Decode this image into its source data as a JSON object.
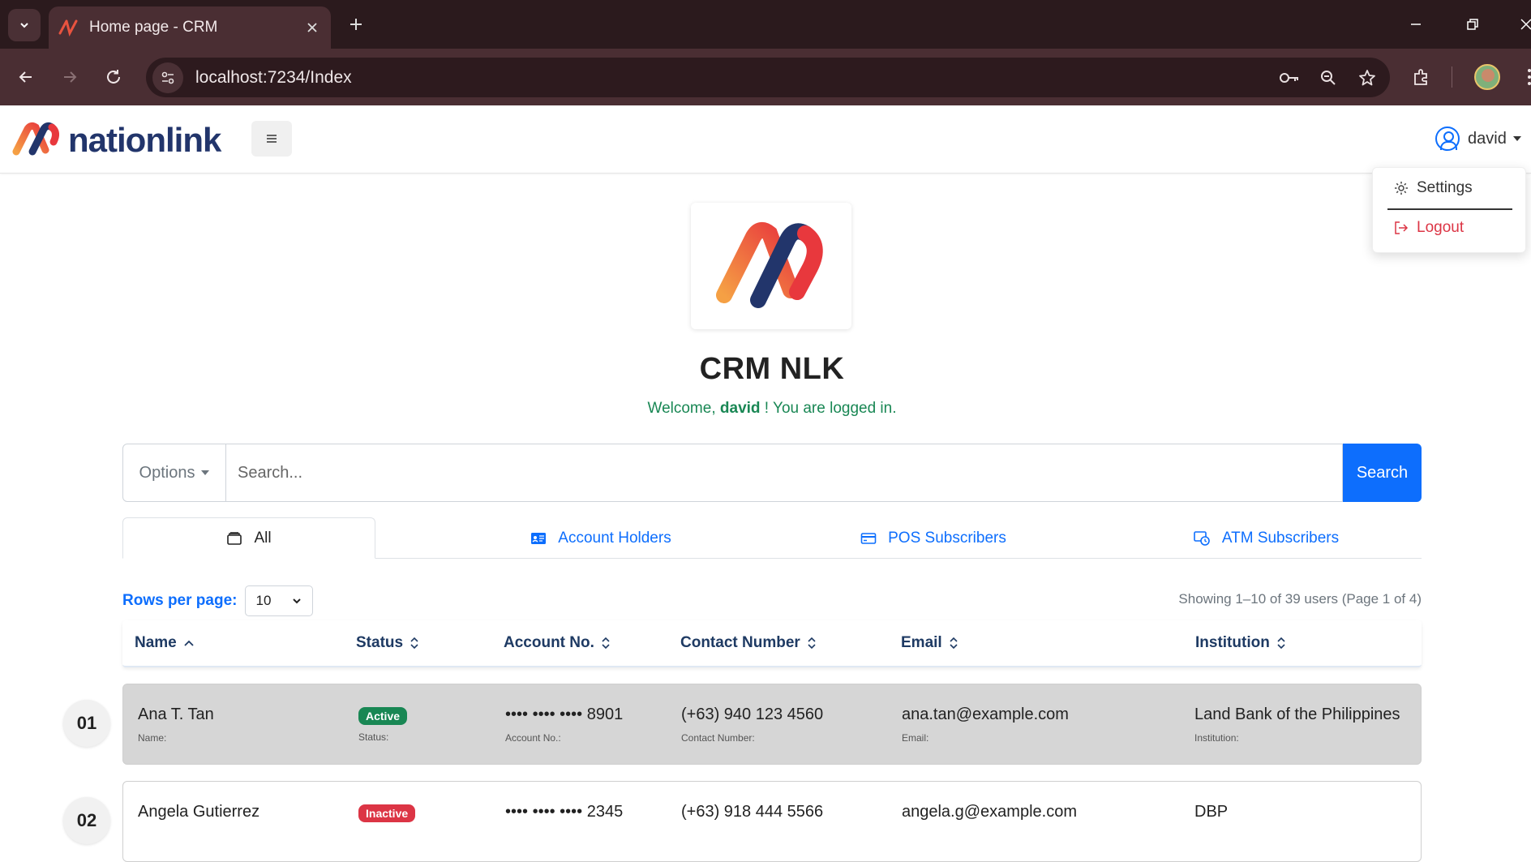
{
  "browser": {
    "tab_title": "Home page - CRM",
    "url": "localhost:7234/Index"
  },
  "app": {
    "brand": "nationlink",
    "user_name": "david",
    "menu": {
      "settings": "Settings",
      "logout": "Logout"
    },
    "title": "CRM NLK",
    "welcome_prefix": "Welcome,",
    "welcome_user": "david",
    "welcome_suffix": "! You are logged in."
  },
  "search": {
    "options_label": "Options",
    "placeholder": "Search...",
    "button_label": "Search"
  },
  "tabs": [
    {
      "label": "All",
      "icon": "wallet-icon",
      "active": true
    },
    {
      "label": "Account Holders",
      "icon": "id-card-icon",
      "active": false
    },
    {
      "label": "POS Subscribers",
      "icon": "credit-card-icon",
      "active": false
    },
    {
      "label": "ATM Subscribers",
      "icon": "atm-icon",
      "active": false
    }
  ],
  "pagination": {
    "rows_label": "Rows per page:",
    "rows_value": "10",
    "showing": "Showing 1–10 of 39 users (Page 1 of 4)"
  },
  "columns": {
    "name": "Name",
    "status": "Status",
    "account": "Account No.",
    "contact": "Contact Number",
    "email": "Email",
    "institution": "Institution"
  },
  "rows": [
    {
      "num": "01",
      "name": "Ana T. Tan",
      "status": "Active",
      "account": "•••• •••• •••• 8901",
      "contact": "(+63) 940 123 4560",
      "email": "ana.tan@example.com",
      "institution": "Land Bank of the Philippines",
      "labels": {
        "name": "Name:",
        "status": "Status:",
        "account": "Account No.:",
        "contact": "Contact Number:",
        "email": "Email:",
        "institution": "Institution:"
      }
    },
    {
      "num": "02",
      "name": "Angela Gutierrez",
      "status": "Inactive",
      "account": "•••• •••• •••• 2345",
      "contact": "(+63) 918 444 5566",
      "email": "angela.g@example.com",
      "institution": "DBP"
    }
  ],
  "colors": {
    "accent": "#0d6efd",
    "success": "#198754",
    "danger": "#dc3545",
    "header_text": "#1e3a63",
    "brand_navy": "#22356b"
  }
}
